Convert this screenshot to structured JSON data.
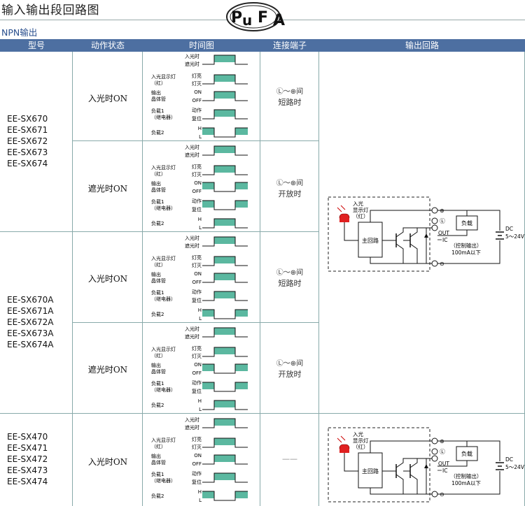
{
  "page": {
    "title": "输入输出段回路图",
    "logo_text": "PuFA",
    "subtitle": "NPN输出"
  },
  "header": {
    "model": "型号",
    "action_state": "动作状态",
    "timing_chart": "时间图",
    "terminals": "连接端子",
    "output_circuit": "输出回路"
  },
  "groups": [
    {
      "models": [
        "EE-SX670",
        "EE-SX671",
        "EE-SX672",
        "EE-SX673",
        "EE-SX674"
      ],
      "rows": [
        {
          "state": "入光时ON",
          "terminal_sym": "Ⓛ～⊕间",
          "terminal_text": "短路时"
        },
        {
          "state": "遮光时ON",
          "terminal_sym": "Ⓛ～⊕间",
          "terminal_text": "开放时"
        }
      ]
    },
    {
      "models": [
        "EE-SX670A",
        "EE-SX671A",
        "EE-SX672A",
        "EE-SX673A",
        "EE-SX674A"
      ],
      "rows": [
        {
          "state": "入光时ON",
          "terminal_sym": "Ⓛ～⊕间",
          "terminal_text": "短路时"
        },
        {
          "state": "遮光时ON",
          "terminal_sym": "Ⓛ～⊕间",
          "terminal_text": "开放时"
        }
      ]
    },
    {
      "models": [
        "EE-SX470",
        "EE-SX471",
        "EE-SX472",
        "EE-SX473",
        "EE-SX474"
      ],
      "rows": [
        {
          "state": "入光时ON",
          "terminal_dash": "——"
        }
      ]
    }
  ],
  "timing_labels": {
    "light_in": "入光时",
    "light_block": "遮光时",
    "indicator_1": "入光显示灯",
    "indicator_2": "（红）",
    "lamp_on": "灯亮",
    "lamp_off": "灯灭",
    "output_1": "输出",
    "output_2": "晶体管",
    "on": "ON",
    "off": "OFF",
    "load1_1": "负载1",
    "load1_2": "（继电器）",
    "operate": "动作",
    "reset": "复位",
    "load2": "负载2",
    "h": "H",
    "l": "L"
  },
  "circuit": {
    "led_1": "入光",
    "led_2": "显示灯",
    "led_3": "（红）",
    "main_circuit": "主回路",
    "load": "负载",
    "out": "OUT",
    "ic": "IC",
    "control_1": "（控制输出）",
    "control_2": "100mA以下",
    "dc": "DC",
    "voltage": "5～24V",
    "plus": "⊕",
    "minus": "⊖",
    "l_term": "Ⓛ"
  },
  "colors": {
    "header_bg": "#4d6fa1",
    "pulse_fill": "#5bb8a0",
    "led_red": "#e02020"
  }
}
